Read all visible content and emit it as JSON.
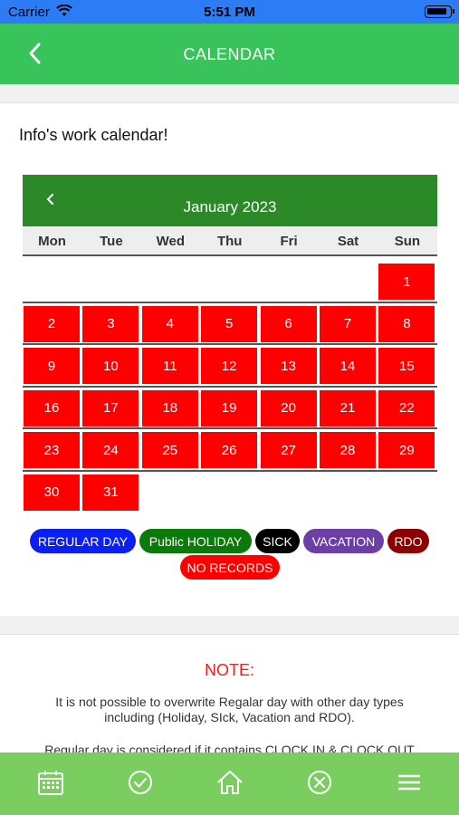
{
  "status_bar": {
    "carrier": "Carrier",
    "time": "5:51 PM"
  },
  "nav": {
    "title": "CALENDAR",
    "back_icon": "chevron-left-icon"
  },
  "intro": "Info's work calendar!",
  "calendar": {
    "month_label": "January 2023",
    "weekdays": [
      "Mon",
      "Tue",
      "Wed",
      "Thu",
      "Fri",
      "Sat",
      "Sun"
    ],
    "days": [
      "1",
      "2",
      "3",
      "4",
      "5",
      "6",
      "7",
      "8",
      "9",
      "10",
      "11",
      "12",
      "13",
      "14",
      "15",
      "16",
      "17",
      "18",
      "19",
      "20",
      "21",
      "22",
      "23",
      "24",
      "25",
      "26",
      "27",
      "28",
      "29",
      "30",
      "31"
    ],
    "day_color": "#ff0000",
    "header_color": "#2b8a27"
  },
  "legend": {
    "regular": "REGULAR DAY",
    "holiday": "Public HOLIDAY",
    "sick": "SICK",
    "vacation": "VACATION",
    "rdo": "RDO",
    "no_records": "NO RECORDS",
    "colors": {
      "regular": "#0a1ff0",
      "holiday": "#0b7a0b",
      "sick": "#000000",
      "vacation": "#6c3fa6",
      "rdo": "#8b0000",
      "no_records": "#ff0000"
    }
  },
  "note": {
    "title": "NOTE:",
    "line1": "It is not possible to overwrite Regalar day with other day types including (Holiday, SIck, Vacation and RDO).",
    "line2": "Regular day is considered if it contains CLOCK IN & CLOCK OUT"
  },
  "tab_bar": {
    "icons": [
      "calendar-icon",
      "check-circle-icon",
      "home-icon",
      "close-circle-icon",
      "menu-icon"
    ],
    "color": "#7ace60"
  }
}
